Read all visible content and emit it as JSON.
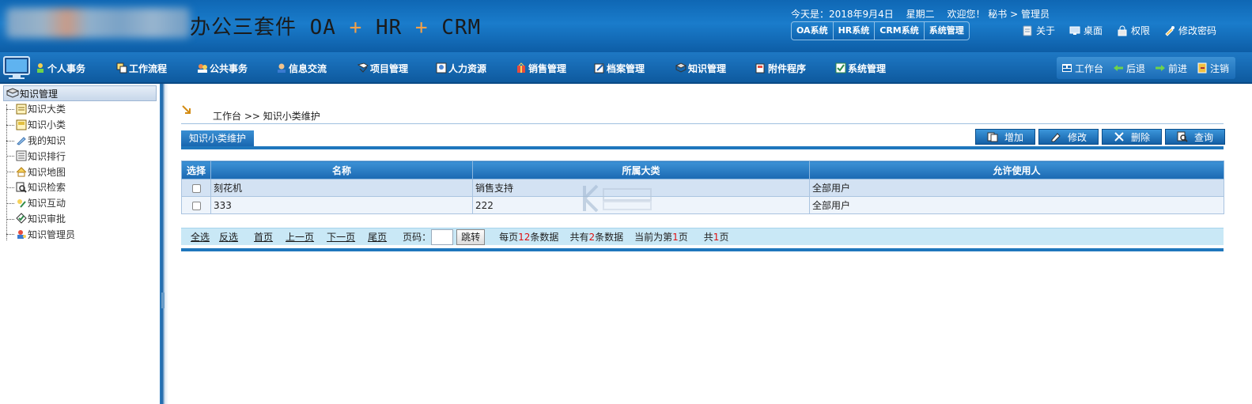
{
  "header": {
    "title_prefix": "办公三套件 OA",
    "plus": "+",
    "title_mid": "HR",
    "title_suffix": "CRM",
    "date_label": "今天是：2018年9月4日",
    "weekday": "星期二",
    "welcome": "欢迎您！ 秘书 > 管理员",
    "system_tabs": [
      "OA系统",
      "HR系统",
      "CRM系统",
      "系统管理"
    ],
    "links": [
      {
        "label": "关于",
        "icon": "about-icon"
      },
      {
        "label": "桌面",
        "icon": "desktop-icon"
      },
      {
        "label": "权限",
        "icon": "permission-icon"
      },
      {
        "label": "修改密码",
        "icon": "password-icon"
      }
    ]
  },
  "menu": {
    "items": [
      {
        "label": "个人事务",
        "icon": "person-icon"
      },
      {
        "label": "工作流程",
        "icon": "workflow-icon"
      },
      {
        "label": "公共事务",
        "icon": "public-affairs-icon"
      },
      {
        "label": "信息交流",
        "icon": "message-icon"
      },
      {
        "label": "项目管理",
        "icon": "project-icon"
      },
      {
        "label": "人力资源",
        "icon": "hr-icon"
      },
      {
        "label": "销售管理",
        "icon": "sales-icon"
      },
      {
        "label": "档案管理",
        "icon": "archive-icon"
      },
      {
        "label": "知识管理",
        "icon": "knowledge-icon"
      },
      {
        "label": "附件程序",
        "icon": "attachment-icon"
      },
      {
        "label": "系统管理",
        "icon": "system-icon"
      }
    ],
    "nav": [
      {
        "label": "工作台",
        "icon": "workbench-icon"
      },
      {
        "label": "后退",
        "icon": "back-arrow-icon"
      },
      {
        "label": "前进",
        "icon": "forward-arrow-icon"
      },
      {
        "label": "注销",
        "icon": "logout-icon"
      }
    ]
  },
  "sidebar": {
    "title": "知识管理",
    "items": [
      {
        "label": "知识大类",
        "icon": "category-icon"
      },
      {
        "label": "知识小类",
        "icon": "subcategory-icon"
      },
      {
        "label": "我的知识",
        "icon": "my-knowledge-icon"
      },
      {
        "label": "知识排行",
        "icon": "ranking-icon"
      },
      {
        "label": "知识地图",
        "icon": "map-icon"
      },
      {
        "label": "知识检索",
        "icon": "search-icon"
      },
      {
        "label": "知识互动",
        "icon": "interaction-icon"
      },
      {
        "label": "知识审批",
        "icon": "approval-icon"
      },
      {
        "label": "知识管理员",
        "icon": "admin-icon"
      }
    ]
  },
  "main": {
    "breadcrumb": "工作台 >> 知识小类维护",
    "section_title": "知识小类维护",
    "actions": [
      {
        "label": "增加",
        "icon": "add-icon"
      },
      {
        "label": "修改",
        "icon": "edit-icon"
      },
      {
        "label": "删除",
        "icon": "delete-icon"
      },
      {
        "label": "查询",
        "icon": "query-icon"
      }
    ],
    "table": {
      "columns": [
        "选择",
        "名称",
        "所属大类",
        "允许使用人"
      ],
      "rows": [
        {
          "name": "刻花机",
          "category": "销售支持",
          "users": "全部用户"
        },
        {
          "name": "333",
          "category": "222",
          "users": "全部用户"
        }
      ]
    },
    "pager": {
      "select_all": "全选",
      "invert": "反选",
      "first": "首页",
      "prev": "上一页",
      "next": "下一页",
      "last": "尾页",
      "page_label": "页码：",
      "jump": "跳转",
      "per_page_pre": "每页",
      "per_page_num": "12",
      "per_page_post": "条数据",
      "total_pre": "共有",
      "total_num": "2",
      "total_post": "条数据",
      "current_pre": "当前为第",
      "current_num": "1",
      "current_post": "页",
      "pages_pre": "共",
      "pages_num": "1",
      "pages_post": "页"
    }
  }
}
